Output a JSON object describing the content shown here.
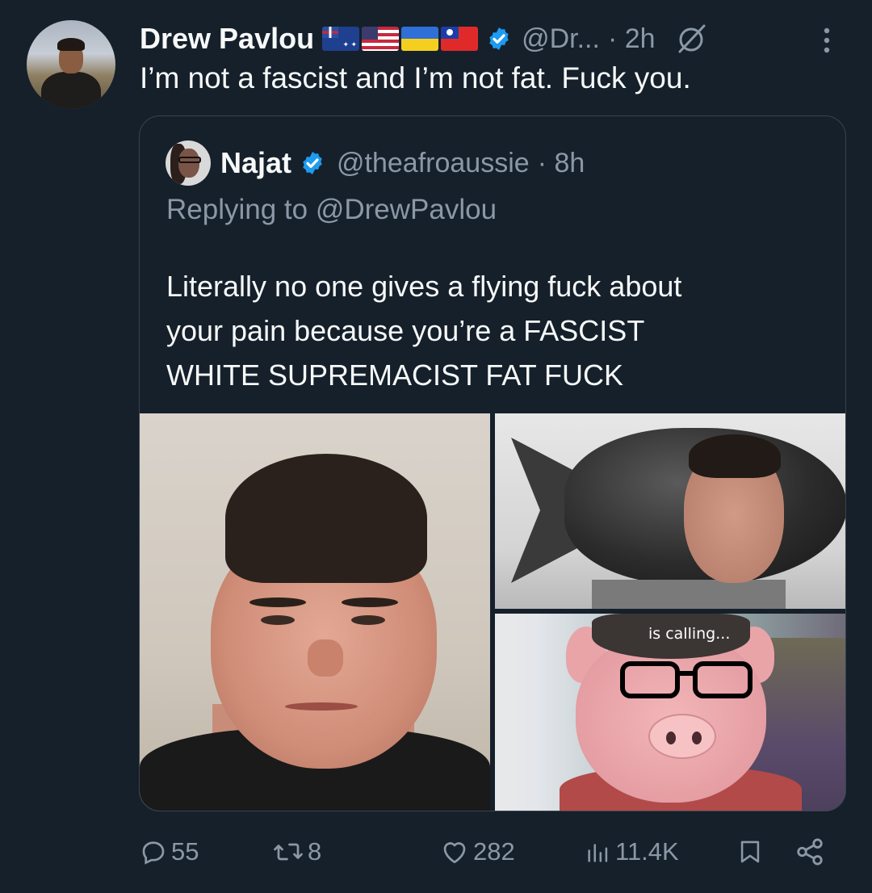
{
  "tweet": {
    "author_name": "Drew Pavlou",
    "flags": [
      "australia-flag",
      "usa-flag",
      "ukraine-flag",
      "taiwan-flag"
    ],
    "handle": "@Dr...",
    "time": "· 2h",
    "text": "I’m not a fascist and I’m not fat. Fuck you."
  },
  "quote": {
    "author_name": "Najat",
    "handle": "@theafroaussie",
    "time": "· 8h",
    "replying_prefix": "Replying to",
    "replying_to": "@DrewPavlou",
    "text_lines": [
      "Literally no one gives a flying fuck about",
      "your pain because you’re a FASCIST",
      "WHITE SUPREMACIST FAT FUCK"
    ],
    "media": {
      "image3_overlay_text": "is calling..."
    }
  },
  "actions": {
    "replies": "55",
    "reposts": "8",
    "likes": "282",
    "views": "11.4K"
  },
  "colors": {
    "background": "#15202b",
    "primary_text": "#f7f9f9",
    "secondary_text": "#8b98a5",
    "verified_blue": "#1d9bf0",
    "border": "#38444d"
  }
}
